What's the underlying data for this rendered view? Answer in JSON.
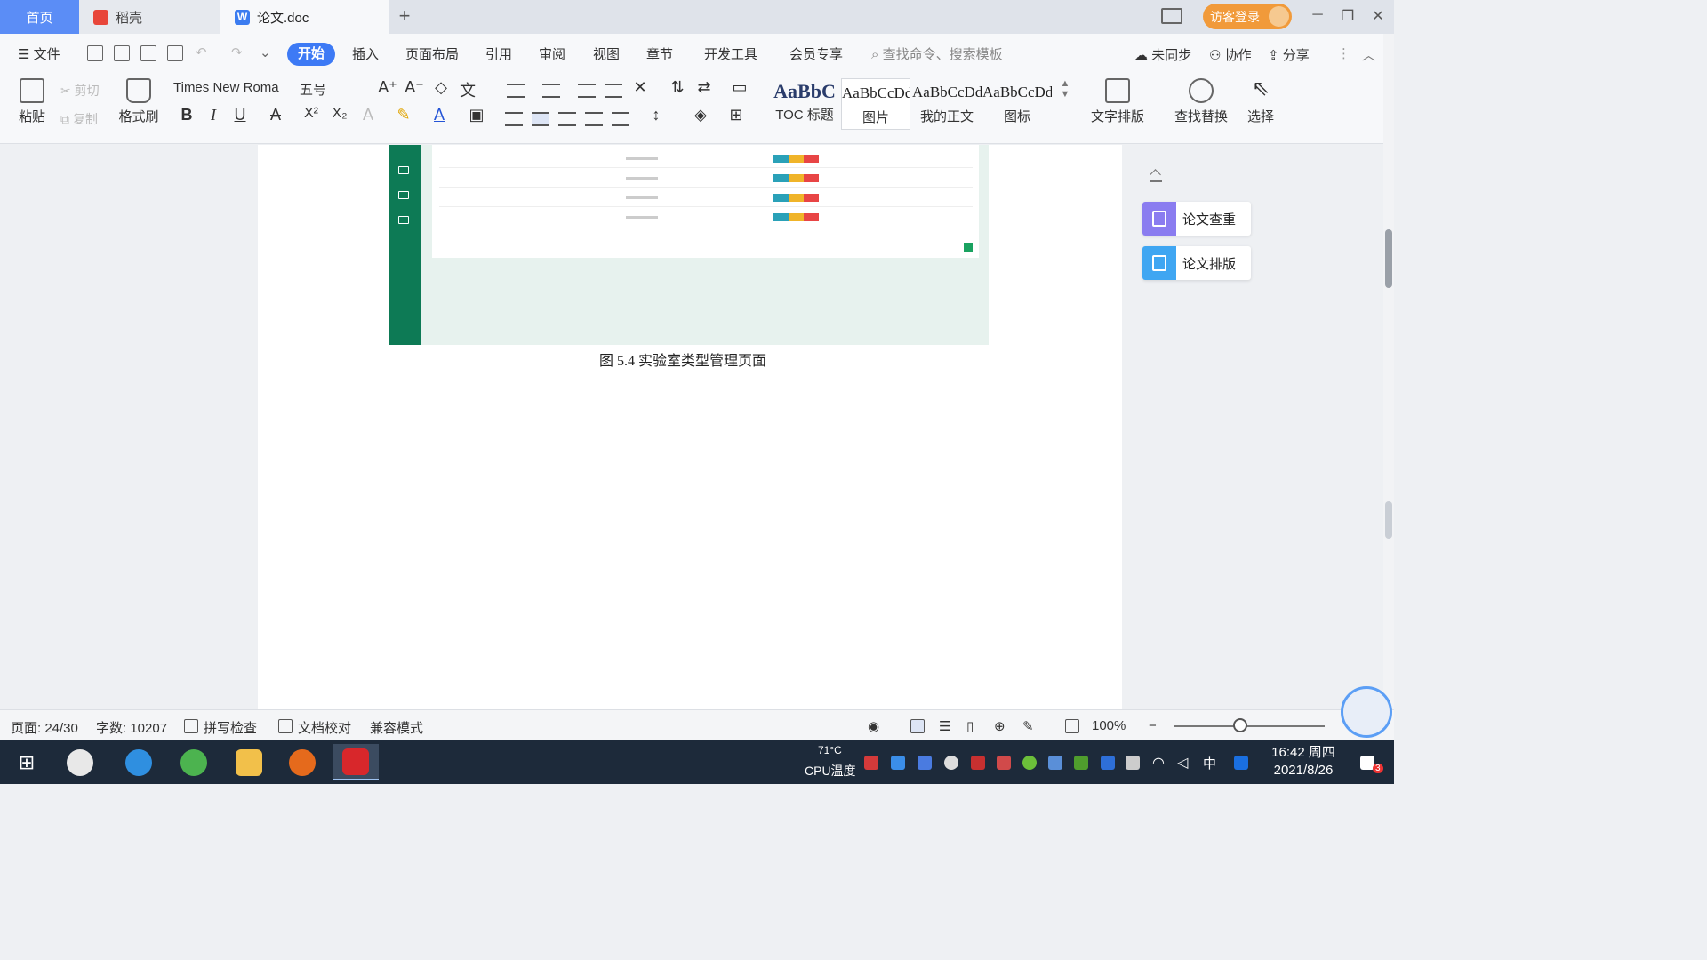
{
  "tabs": {
    "home": "首页",
    "daoke": "稻壳",
    "doc": "论文.doc",
    "new_tab": "+"
  },
  "titlebar": {
    "login": "访客登录",
    "minimize": "─",
    "restore": "❐",
    "close": "✕"
  },
  "menu": {
    "file": "文件",
    "start": "开始",
    "insert": "插入",
    "layout": "页面布局",
    "reference": "引用",
    "review": "审阅",
    "view": "视图",
    "chapter": "章节",
    "dev": "开发工具",
    "member": "会员专享",
    "search": "查找命令、搜索模板",
    "unsync": "未同步",
    "collab": "协作",
    "share": "分享"
  },
  "ribbon": {
    "paste": "粘贴",
    "cut": "剪切",
    "copy": "复制",
    "format_painter": "格式刷",
    "font_name": "Times New Roma",
    "font_size": "五号",
    "bold": "B",
    "italic": "I",
    "underline": "U",
    "strike": "A",
    "superscript": "X²",
    "subscript": "X₂",
    "styles": [
      {
        "sample": "AaBbC",
        "label": "TOC 标题"
      },
      {
        "sample": "AaBbCcDd",
        "label": "图片"
      },
      {
        "sample": "AaBbCcDd",
        "label": "我的正文"
      },
      {
        "sample": "AaBbCcDd",
        "label": "图标"
      }
    ],
    "text_layout": "文字排版",
    "find_replace": "查找替换",
    "select": "选择"
  },
  "document": {
    "caption": "图 5.4  实验室类型管理页面"
  },
  "side_panel": {
    "check": "论文查重",
    "typeset": "论文排版"
  },
  "statusbar": {
    "page": "页面: 24/30",
    "words": "字数: 10207",
    "spell": "拼写检查",
    "proof": "文档校对",
    "compat": "兼容模式",
    "zoom": "100%",
    "zoom_level": 0.44
  },
  "taskbar": {
    "cpu_temp": "71°C",
    "cpu_label": "CPU温度",
    "ime": "中",
    "time": "16:42 周四",
    "date": "2021/8/26",
    "notify_count": "3"
  },
  "colors": {
    "accent": "#3d7af5",
    "home_tab": "#5b8df6",
    "login": "#f19a3a",
    "sidebar_green": "#0d7a55",
    "taskbar": "#1d2a3a"
  }
}
